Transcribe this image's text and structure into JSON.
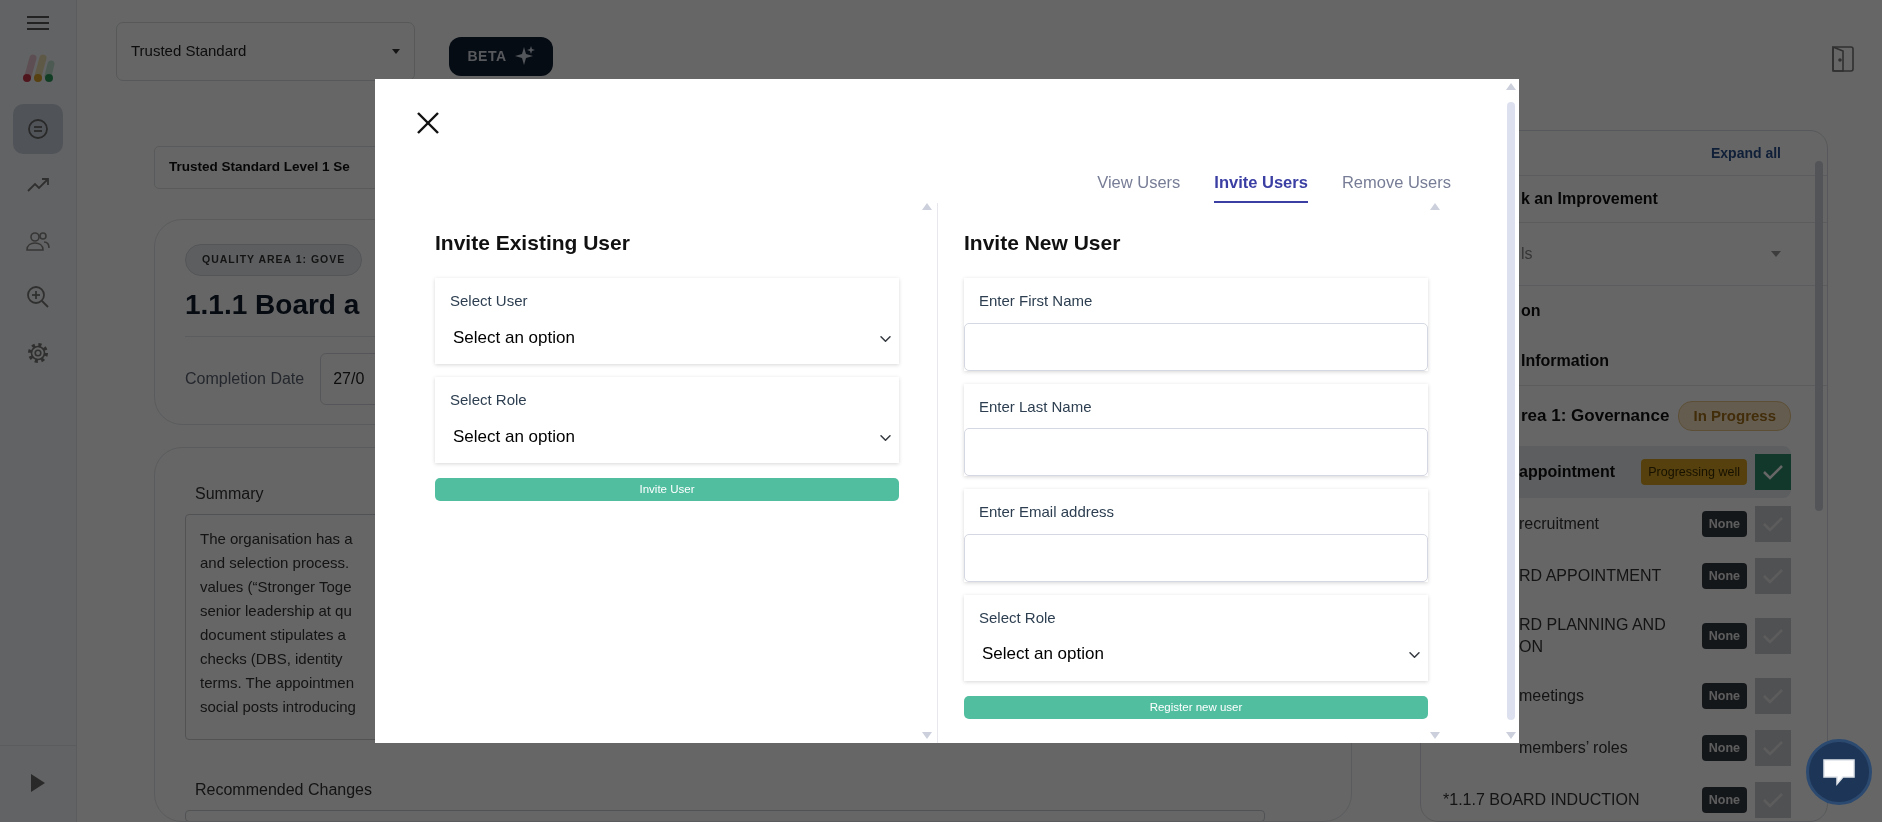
{
  "sidebar": {
    "items": [
      {
        "selected": true
      },
      {
        "selected": false
      },
      {
        "selected": false
      },
      {
        "selected": false
      },
      {
        "selected": false
      }
    ]
  },
  "top_bar": {
    "standard_select": "Trusted Standard",
    "beta_button": "BETA"
  },
  "main": {
    "breadcrumb": "Trusted Standard Level 1 Se",
    "area_pill": "QUALITY AREA 1: GOVE",
    "title": "1.1.1 Board a",
    "completion_label": "Completion Date",
    "completion_value": "27/0",
    "summary_label": "Summary",
    "summary_lines": [
      "The organisation has a",
      "and selection process.",
      "values (“Stronger Toge",
      "senior leadership at qu",
      "document stipulates a",
      "checks (DBS, identity",
      "terms. The appointmen",
      "social posts introducing"
    ],
    "recommended_label": "Recommended Changes"
  },
  "right_panel": {
    "expand_all": "Expand all",
    "items": [
      {
        "kind": "heading",
        "text": "k an Improvement"
      },
      {
        "kind": "dropdown",
        "text": "ls"
      },
      {
        "kind": "link",
        "text": "on"
      },
      {
        "kind": "link",
        "text": "Information"
      }
    ],
    "area": {
      "title": "rea 1: Governance",
      "status": "In Progress"
    },
    "rows": [
      {
        "lines": [
          "appointment"
        ],
        "status": "Progressing well",
        "kind": "warning",
        "done": true,
        "selected": true
      },
      {
        "lines": [
          "recruitment"
        ],
        "status": "None",
        "kind": "none",
        "done": false,
        "selected": false
      },
      {
        "lines": [
          "RD APPOINTMENT"
        ],
        "status": "None",
        "kind": "none",
        "done": false,
        "selected": false
      },
      {
        "lines": [
          "RD PLANNING AND",
          "ON"
        ],
        "status": "None",
        "kind": "none",
        "done": false,
        "selected": false
      },
      {
        "lines": [
          "meetings"
        ],
        "status": "None",
        "kind": "none",
        "done": false,
        "selected": false
      },
      {
        "lines": [
          "members’ roles"
        ],
        "status": "None",
        "kind": "none",
        "done": false,
        "selected": false
      },
      {
        "lines": [
          "*1.1.7 BOARD INDUCTION"
        ],
        "status": "None",
        "kind": "none",
        "done": false,
        "selected": false
      }
    ]
  },
  "modal": {
    "tabs": [
      {
        "label": "View Users",
        "selected": false
      },
      {
        "label": "Invite Users",
        "selected": true
      },
      {
        "label": "Remove Users",
        "selected": false
      }
    ],
    "existing": {
      "heading": "Invite Existing User",
      "fields": [
        {
          "kind": "select",
          "label": "Select User",
          "value": "Select an option"
        },
        {
          "kind": "select",
          "label": "Select Role",
          "value": "Select an option"
        }
      ],
      "button": "Invite User"
    },
    "new": {
      "heading": "Invite New User",
      "fields": [
        {
          "kind": "text",
          "label": "Enter First Name"
        },
        {
          "kind": "text",
          "label": "Enter Last Name"
        },
        {
          "kind": "text",
          "label": "Enter Email address"
        },
        {
          "kind": "select",
          "label": "Select Role",
          "value": "Select an option"
        }
      ],
      "button": "Register new user"
    }
  }
}
